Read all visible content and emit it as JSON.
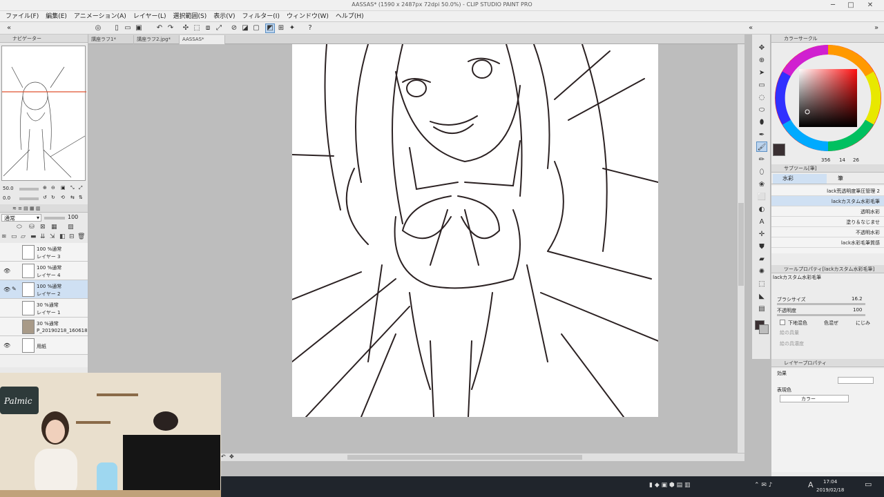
{
  "window": {
    "title": "AASSAS* (1590 x 2487px 72dpi 50.0%) - CLIP STUDIO PAINT PRO",
    "minimize": "─",
    "maximize": "□",
    "close": "✕"
  },
  "menu": [
    "ファイル(F)",
    "編集(E)",
    "アニメーション(A)",
    "レイヤー(L)",
    "選択範囲(S)",
    "表示(V)",
    "フィルター(I)",
    "ウィンドウ(W)",
    "ヘルプ(H)"
  ],
  "tabs": [
    {
      "label": "講座ラフ1*"
    },
    {
      "label": "講座ラフ2.jpg*"
    },
    {
      "label": "AASSAS*"
    }
  ],
  "navigator": {
    "label": "ナビゲーター",
    "zoom_value": "50.0",
    "rotate_value": "0.0"
  },
  "layers_panel": {
    "blend_mode": "通常",
    "opacity": "100",
    "layers": [
      {
        "line1": "100 %通常",
        "line2": "レイヤー 3",
        "visible": false,
        "selected": false
      },
      {
        "line1": "100 %通常",
        "line2": "レイヤー 4",
        "visible": true,
        "selected": false
      },
      {
        "line1": "100 %通常",
        "line2": "レイヤー 2",
        "visible": true,
        "selected": true
      },
      {
        "line1": "30 %通常",
        "line2": "レイヤー 1",
        "visible": false,
        "selected": false
      },
      {
        "line1": "30 %通常",
        "line2": "P_20190218_160618",
        "visible": false,
        "selected": false
      },
      {
        "line1": "",
        "line2": "用紙",
        "visible": true,
        "selected": false
      }
    ]
  },
  "color_circle": {
    "label": "カラーサークル",
    "hsv_h": "356",
    "hsv_s": "14",
    "hsv_v": "26"
  },
  "sub_tool": {
    "label": "サブツール[筆]",
    "tab_watercolor": "水彩",
    "tab_brush": "筆",
    "brushes": [
      {
        "name": "lack荒透明度筆圧管理 2",
        "selected": false
      },
      {
        "name": "lackカスタム水彩毛筆",
        "selected": true
      },
      {
        "name": "透明水彩",
        "selected": false
      },
      {
        "name": "塗り＆なじませ",
        "selected": false
      },
      {
        "name": "不透明水彩",
        "selected": false
      },
      {
        "name": "lack水彩毛筆質感",
        "selected": false
      }
    ]
  },
  "tool_property": {
    "label": "ツールプロパティ[lackカスタム水彩毛筆]",
    "brush_name": "lackカスタム水彩毛筆",
    "size_label": "ブラシサイズ",
    "size_value": "16.2",
    "opacity_label": "不透明度",
    "opacity_value": "100",
    "underlay_label": "下地混色",
    "color_mix_label": "色混ぜ",
    "blur_label": "にじみ",
    "paint_amount_label": "絵の具量",
    "paint_density_label": "絵の具濃度"
  },
  "layer_property": {
    "label": "レイヤープロパティ",
    "effect_label": "効果",
    "expression_label": "表現色",
    "expression_value": "カラー"
  },
  "taskbar": {
    "time": "17:04",
    "date": "2019/02/18",
    "ime": "A"
  },
  "webcam": {
    "sign_text": "Palmic"
  },
  "colors": {
    "selection": "#cfe0f3",
    "accent": "#5a8fc4",
    "nav_guide": "#e0502e"
  }
}
